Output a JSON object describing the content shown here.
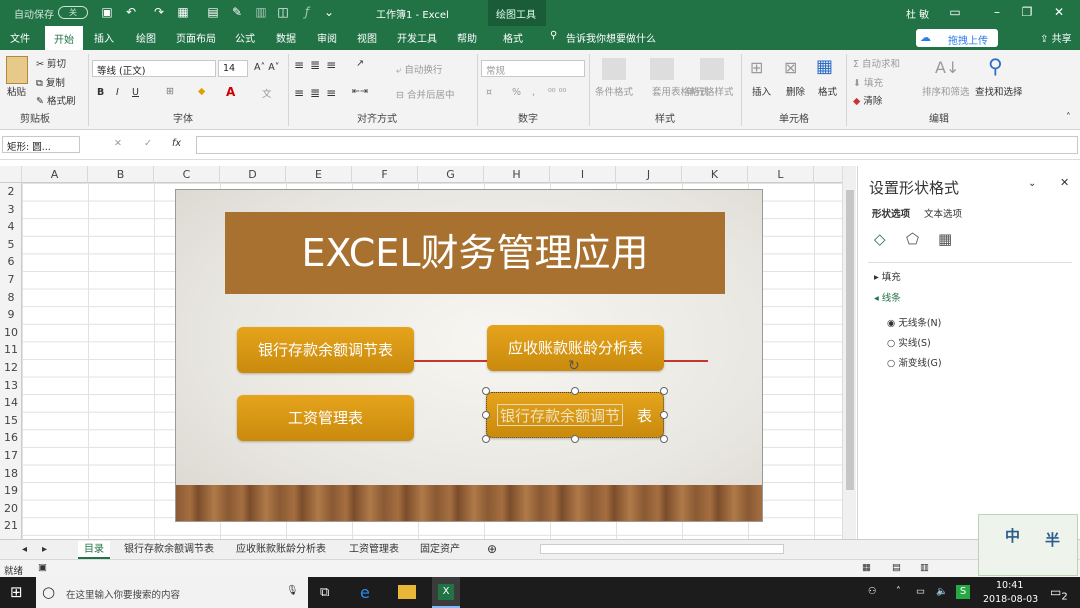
{
  "titlebar": {
    "autosave": "自动保存",
    "autosave_state": "关",
    "doc_title": "工作簿1 - Excel",
    "context_tool": "绘图工具",
    "user": "杜 敏"
  },
  "tabs": [
    "文件",
    "开始",
    "插入",
    "绘图",
    "页面布局",
    "公式",
    "数据",
    "审阅",
    "视图",
    "开发工具",
    "帮助",
    "格式"
  ],
  "tell_me": "告诉我你想要做什么",
  "upload": "拖拽上传",
  "share": "共享",
  "ribbon": {
    "clipboard": {
      "paste": "粘贴",
      "cut": "剪切",
      "copy": "复制",
      "format_painter": "格式刷",
      "label": "剪贴板"
    },
    "font": {
      "name": "等线 (正文)",
      "size": "14",
      "label": "字体",
      "bold": "B",
      "italic": "I",
      "underline": "U"
    },
    "align": {
      "wrap": "自动换行",
      "merge": "合并后居中",
      "label": "对齐方式"
    },
    "number": {
      "format": "常规",
      "percent": "%",
      "label": "数字"
    },
    "styles": {
      "conditional": "条件格式",
      "table": "套用表格格式",
      "cell": "单元格样式",
      "label": "样式"
    },
    "cells": {
      "insert": "插入",
      "delete": "删除",
      "format": "格式",
      "label": "单元格"
    },
    "editing": {
      "autosum": "自动求和",
      "fill": "填充",
      "clear": "清除",
      "sort": "排序和筛选",
      "find": "查找和选择",
      "label": "编辑"
    }
  },
  "formula": {
    "namebox": "矩形: 圆...",
    "fx": "fx"
  },
  "columns": [
    "A",
    "B",
    "C",
    "D",
    "E",
    "F",
    "G",
    "H",
    "I",
    "J",
    "K",
    "L"
  ],
  "rows": [
    "2",
    "3",
    "4",
    "5",
    "6",
    "7",
    "8",
    "9",
    "10",
    "11",
    "12",
    "13",
    "14",
    "15",
    "16",
    "17",
    "18",
    "19",
    "20",
    "21"
  ],
  "slide": {
    "title": "EXCEL财务管理应用",
    "btn1": "银行存款余额调节表",
    "btn2": "应收账款账龄分析表",
    "btn3": "工资管理表",
    "btn4_selected": "银行存款余额调节",
    "btn4_tail": "表"
  },
  "pane": {
    "title": "设置形状格式",
    "tab_shape": "形状选项",
    "tab_text": "文本选项",
    "fill": "填充",
    "line": "线条",
    "no_line": "无线条(N)",
    "solid_line": "实线(S)",
    "gradient_line": "渐变线(G)"
  },
  "sheets": [
    "目录",
    "银行存款余额调节表",
    "应收账款账龄分析表",
    "工资管理表",
    "固定资产"
  ],
  "status": {
    "ready": "就绪"
  },
  "taskbar": {
    "search": "在这里输入你要搜索的内容",
    "time": "10:41",
    "date": "2018-08-03",
    "notify": "2"
  },
  "watermark": {
    "c1": "中",
    "c2": "半"
  },
  "colors": {
    "excel_green": "#217346",
    "banner": "#a8712f",
    "gold": "#d9970f"
  }
}
